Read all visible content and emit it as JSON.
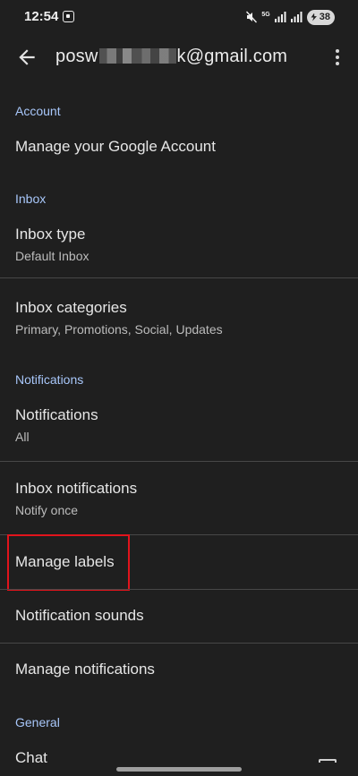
{
  "status_bar": {
    "time": "12:54",
    "network_label": "5G",
    "battery_percent": "38"
  },
  "app_bar": {
    "email_prefix": "posw",
    "email_suffix": "k@gmail.com",
    "back_icon": "arrow-back-icon",
    "overflow_icon": "more-vert-icon"
  },
  "sections": {
    "account": "Account",
    "inbox": "Inbox",
    "notifications": "Notifications",
    "general": "General"
  },
  "rows": {
    "manage_account": {
      "title": "Manage your Google Account"
    },
    "inbox_type": {
      "title": "Inbox type",
      "subtitle": "Default Inbox"
    },
    "inbox_categories": {
      "title": "Inbox categories",
      "subtitle": "Primary, Promotions, Social, Updates"
    },
    "notifications": {
      "title": "Notifications",
      "subtitle": "All"
    },
    "inbox_notifications": {
      "title": "Inbox notifications",
      "subtitle": "Notify once"
    },
    "manage_labels": {
      "title": "Manage labels"
    },
    "notification_sounds": {
      "title": "Notification sounds"
    },
    "manage_notifications": {
      "title": "Manage notifications"
    },
    "chat": {
      "title": "Chat"
    }
  },
  "colors": {
    "background": "#1f1f1f",
    "section_header": "#a8c7fa",
    "highlight": "#e1141c"
  }
}
